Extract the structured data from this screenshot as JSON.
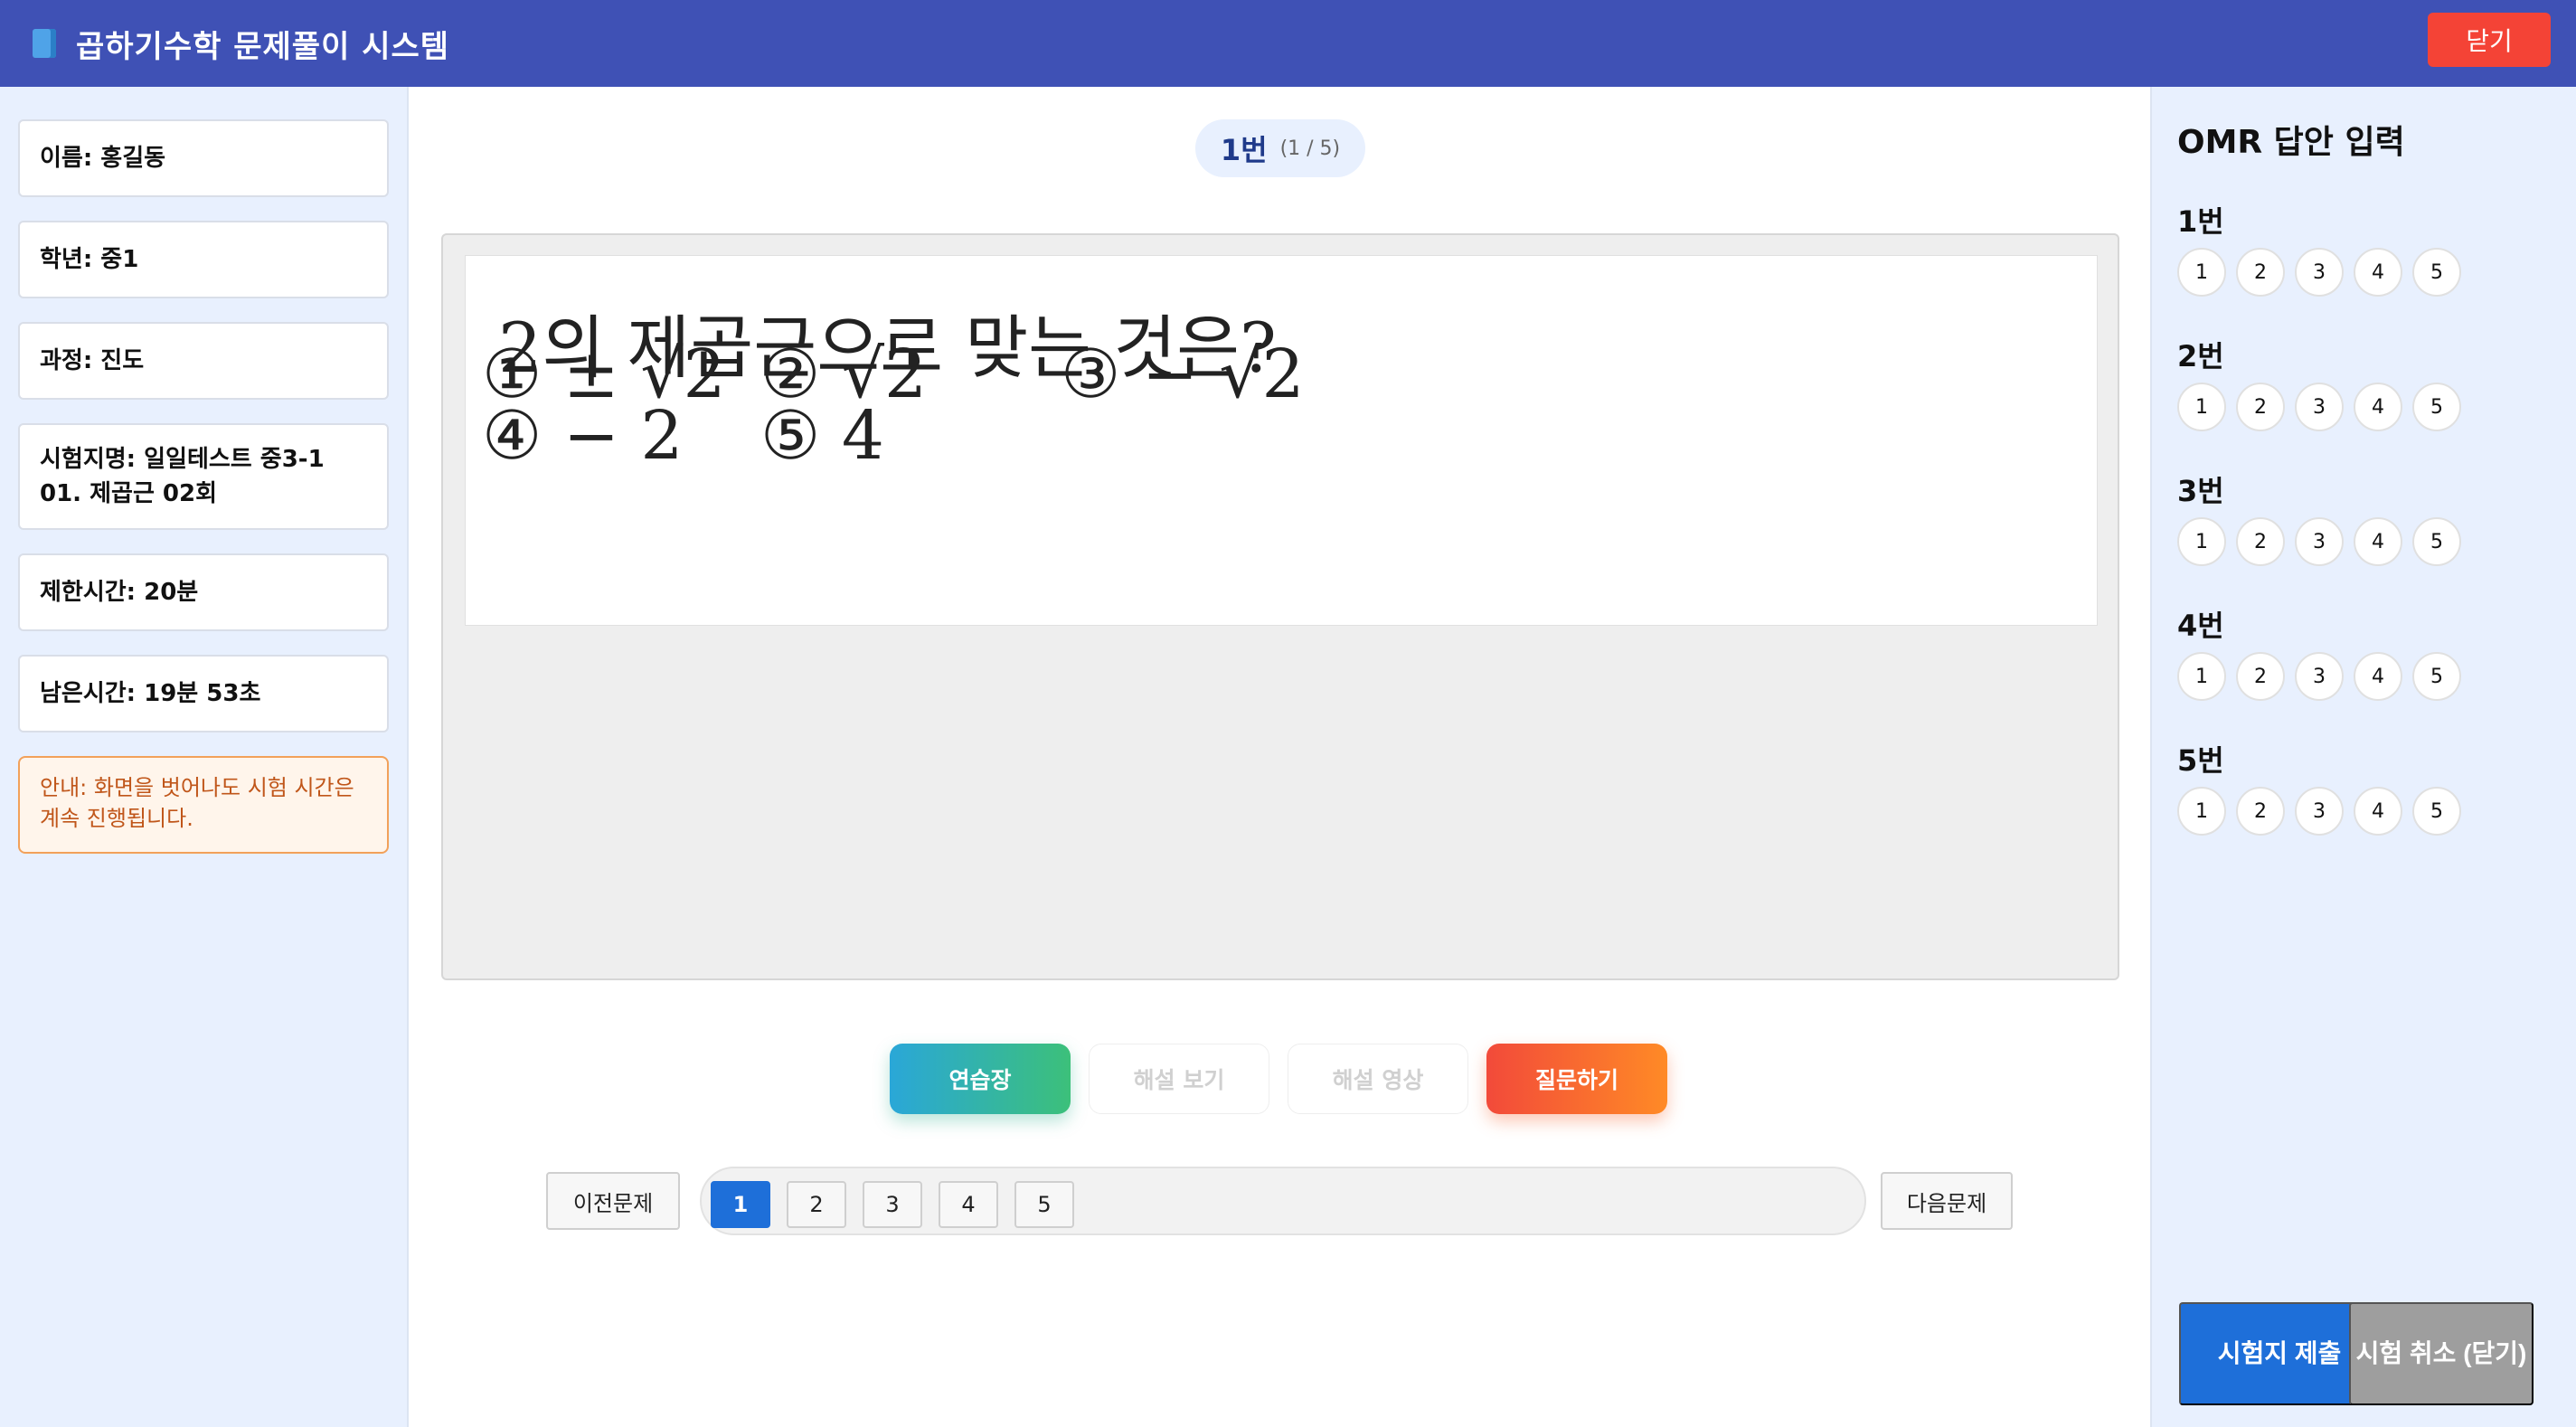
{
  "header": {
    "icon": "book-icon",
    "title": "곱하기수학 문제풀이 시스템",
    "close_label": "닫기"
  },
  "sidebar": {
    "name": "이름: 홍길동",
    "grade": "학년: 중1",
    "course": "과정: 진도",
    "exam_name": "시험지명: 일일테스트 중3-1 01. 제곱근 02회",
    "time_limit": "제한시간: 20분",
    "time_left": "남은시간: 19분 53초",
    "notice": "안내: 화면을 벗어나도 시험 시간은 계속 진행됩니다."
  },
  "question": {
    "number_label": "1번",
    "progress": "(1 / 5)",
    "text": "2의 제곱근으로 맞는 것은?",
    "options": [
      {
        "marker": "①",
        "value": "± √2"
      },
      {
        "marker": "②",
        "value": "√2"
      },
      {
        "marker": "③",
        "value": "− √2"
      },
      {
        "marker": "④",
        "value": "− 2"
      },
      {
        "marker": "⑤",
        "value": "4"
      }
    ]
  },
  "actions": {
    "practice": "연습장",
    "view_solution": "해설 보기",
    "solution_video": "해설 영상",
    "ask": "질문하기"
  },
  "pager": {
    "prev": "이전문제",
    "next": "다음문제",
    "pages": [
      "1",
      "2",
      "3",
      "4",
      "5"
    ],
    "current": "1"
  },
  "omr": {
    "title": "OMR 답안 입력",
    "questions": [
      {
        "label": "1번",
        "choices": [
          "1",
          "2",
          "3",
          "4",
          "5"
        ]
      },
      {
        "label": "2번",
        "choices": [
          "1",
          "2",
          "3",
          "4",
          "5"
        ]
      },
      {
        "label": "3번",
        "choices": [
          "1",
          "2",
          "3",
          "4",
          "5"
        ]
      },
      {
        "label": "4번",
        "choices": [
          "1",
          "2",
          "3",
          "4",
          "5"
        ]
      },
      {
        "label": "5번",
        "choices": [
          "1",
          "2",
          "3",
          "4",
          "5"
        ]
      }
    ],
    "submit": "시험지 제출",
    "cancel": "시험 취소 (닫기)"
  },
  "colors": {
    "header": "#3f51b5",
    "close": "#f44336",
    "primary": "#1e6fd9",
    "sidebar_bg": "#e8f0fe"
  }
}
